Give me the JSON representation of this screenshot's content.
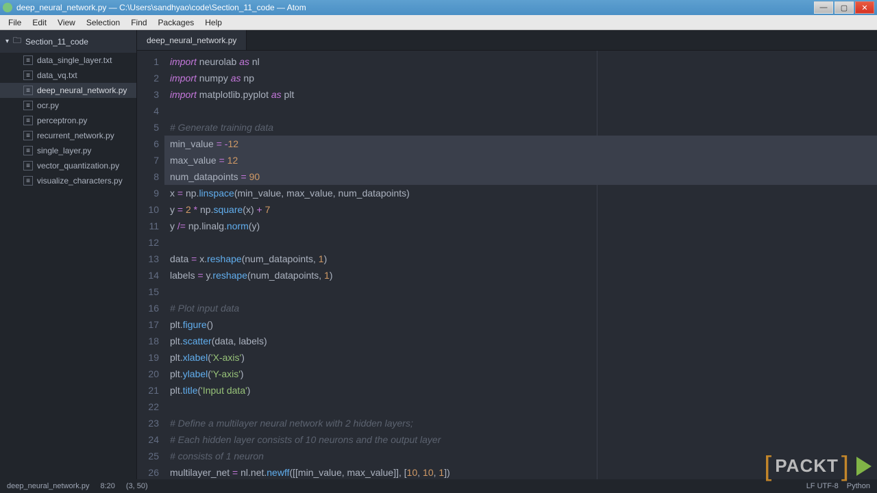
{
  "window": {
    "title": "deep_neural_network.py — C:\\Users\\sandhyao\\code\\Section_11_code — Atom"
  },
  "menu": [
    "File",
    "Edit",
    "View",
    "Selection",
    "Find",
    "Packages",
    "Help"
  ],
  "project": {
    "name": "Section_11_code",
    "files": [
      "data_single_layer.txt",
      "data_vq.txt",
      "deep_neural_network.py",
      "ocr.py",
      "perceptron.py",
      "recurrent_network.py",
      "single_layer.py",
      "vector_quantization.py",
      "visualize_characters.py"
    ],
    "active_index": 2
  },
  "tabs": [
    "deep_neural_network.py"
  ],
  "statusbar": {
    "filename": "deep_neural_network.py",
    "cursor": "8:20",
    "range": "(3, 50)",
    "encoding": "LF  UTF-8",
    "language": "Python"
  },
  "code_lines": [
    {
      "n": 1,
      "sel": false,
      "tokens": [
        [
          "kw",
          "import"
        ],
        [
          "nm",
          " "
        ],
        [
          "mod",
          "neurolab"
        ],
        [
          "nm",
          " "
        ],
        [
          "as",
          "as"
        ],
        [
          "nm",
          " "
        ],
        [
          "alias",
          "nl"
        ]
      ]
    },
    {
      "n": 2,
      "sel": false,
      "tokens": [
        [
          "kw",
          "import"
        ],
        [
          "nm",
          " "
        ],
        [
          "mod",
          "numpy"
        ],
        [
          "nm",
          " "
        ],
        [
          "as",
          "as"
        ],
        [
          "nm",
          " "
        ],
        [
          "alias",
          "np"
        ]
      ]
    },
    {
      "n": 3,
      "sel": false,
      "tokens": [
        [
          "kw",
          "import"
        ],
        [
          "nm",
          " "
        ],
        [
          "mod",
          "matplotlib.pyplot"
        ],
        [
          "nm",
          " "
        ],
        [
          "as",
          "as"
        ],
        [
          "nm",
          " "
        ],
        [
          "alias",
          "plt"
        ]
      ]
    },
    {
      "n": 4,
      "sel": false,
      "tokens": []
    },
    {
      "n": 5,
      "sel": false,
      "tokens": [
        [
          "cmt",
          "# Generate training data"
        ]
      ]
    },
    {
      "n": 6,
      "sel": true,
      "tokens": [
        [
          "nm",
          "min_value "
        ],
        [
          "op",
          "="
        ],
        [
          "nm",
          " "
        ],
        [
          "op",
          "-"
        ],
        [
          "num",
          "12"
        ]
      ]
    },
    {
      "n": 7,
      "sel": true,
      "tokens": [
        [
          "nm",
          "max_value "
        ],
        [
          "op",
          "="
        ],
        [
          "nm",
          " "
        ],
        [
          "num",
          "12"
        ]
      ]
    },
    {
      "n": 8,
      "sel": true,
      "tokens": [
        [
          "nm",
          "num_datapoints "
        ],
        [
          "op",
          "="
        ],
        [
          "nm",
          " "
        ],
        [
          "num",
          "90"
        ]
      ]
    },
    {
      "n": 9,
      "sel": false,
      "tokens": [
        [
          "nm",
          "x "
        ],
        [
          "op",
          "="
        ],
        [
          "nm",
          " np."
        ],
        [
          "fn",
          "linspace"
        ],
        [
          "nm",
          "(min_value, max_value, num_datapoints)"
        ]
      ]
    },
    {
      "n": 10,
      "sel": false,
      "tokens": [
        [
          "nm",
          "y "
        ],
        [
          "op",
          "="
        ],
        [
          "nm",
          " "
        ],
        [
          "num",
          "2"
        ],
        [
          "nm",
          " "
        ],
        [
          "op",
          "*"
        ],
        [
          "nm",
          " np."
        ],
        [
          "fn",
          "square"
        ],
        [
          "nm",
          "(x) "
        ],
        [
          "op",
          "+"
        ],
        [
          "nm",
          " "
        ],
        [
          "num",
          "7"
        ]
      ]
    },
    {
      "n": 11,
      "sel": false,
      "tokens": [
        [
          "nm",
          "y "
        ],
        [
          "op",
          "/="
        ],
        [
          "nm",
          " np.linalg."
        ],
        [
          "fn",
          "norm"
        ],
        [
          "nm",
          "(y)"
        ]
      ]
    },
    {
      "n": 12,
      "sel": false,
      "tokens": []
    },
    {
      "n": 13,
      "sel": false,
      "tokens": [
        [
          "nm",
          "data "
        ],
        [
          "op",
          "="
        ],
        [
          "nm",
          " x."
        ],
        [
          "fn",
          "reshape"
        ],
        [
          "nm",
          "(num_datapoints, "
        ],
        [
          "num",
          "1"
        ],
        [
          "nm",
          ")"
        ]
      ]
    },
    {
      "n": 14,
      "sel": false,
      "tokens": [
        [
          "nm",
          "labels "
        ],
        [
          "op",
          "="
        ],
        [
          "nm",
          " y."
        ],
        [
          "fn",
          "reshape"
        ],
        [
          "nm",
          "(num_datapoints, "
        ],
        [
          "num",
          "1"
        ],
        [
          "nm",
          ")"
        ]
      ]
    },
    {
      "n": 15,
      "sel": false,
      "tokens": []
    },
    {
      "n": 16,
      "sel": false,
      "tokens": [
        [
          "cmt",
          "# Plot input data"
        ]
      ]
    },
    {
      "n": 17,
      "sel": false,
      "tokens": [
        [
          "nm",
          "plt."
        ],
        [
          "fn",
          "figure"
        ],
        [
          "nm",
          "()"
        ]
      ]
    },
    {
      "n": 18,
      "sel": false,
      "tokens": [
        [
          "nm",
          "plt."
        ],
        [
          "fn",
          "scatter"
        ],
        [
          "nm",
          "(data, labels)"
        ]
      ]
    },
    {
      "n": 19,
      "sel": false,
      "tokens": [
        [
          "nm",
          "plt."
        ],
        [
          "fn",
          "xlabel"
        ],
        [
          "nm",
          "("
        ],
        [
          "str",
          "'X-axis'"
        ],
        [
          "nm",
          ")"
        ]
      ]
    },
    {
      "n": 20,
      "sel": false,
      "tokens": [
        [
          "nm",
          "plt."
        ],
        [
          "fn",
          "ylabel"
        ],
        [
          "nm",
          "("
        ],
        [
          "str",
          "'Y-axis'"
        ],
        [
          "nm",
          ")"
        ]
      ]
    },
    {
      "n": 21,
      "sel": false,
      "tokens": [
        [
          "nm",
          "plt."
        ],
        [
          "fn",
          "title"
        ],
        [
          "nm",
          "("
        ],
        [
          "str",
          "'Input data'"
        ],
        [
          "nm",
          ")"
        ]
      ]
    },
    {
      "n": 22,
      "sel": false,
      "tokens": []
    },
    {
      "n": 23,
      "sel": false,
      "tokens": [
        [
          "cmt",
          "# Define a multilayer neural network with 2 hidden layers;"
        ]
      ]
    },
    {
      "n": 24,
      "sel": false,
      "tokens": [
        [
          "cmt",
          "# Each hidden layer consists of 10 neurons and the output layer"
        ]
      ]
    },
    {
      "n": 25,
      "sel": false,
      "tokens": [
        [
          "cmt",
          "# consists of 1 neuron"
        ]
      ]
    },
    {
      "n": 26,
      "sel": false,
      "tokens": [
        [
          "nm",
          "multilayer_net "
        ],
        [
          "op",
          "="
        ],
        [
          "nm",
          " nl.net."
        ],
        [
          "fn",
          "newff"
        ],
        [
          "nm",
          "([[min_value, max_value]], ["
        ],
        [
          "num",
          "10"
        ],
        [
          "nm",
          ", "
        ],
        [
          "num",
          "10"
        ],
        [
          "nm",
          ", "
        ],
        [
          "num",
          "1"
        ],
        [
          "nm",
          "])"
        ]
      ]
    }
  ],
  "packt": {
    "text": "PACKT"
  }
}
